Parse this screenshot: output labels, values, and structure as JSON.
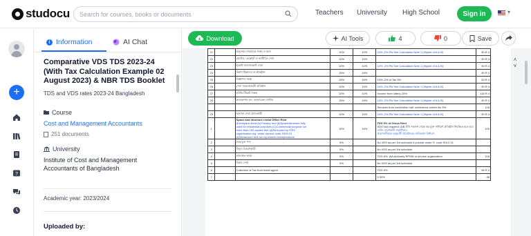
{
  "brand": {
    "name": "studocu"
  },
  "search": {
    "placeholder": "Search for courses, books or documents"
  },
  "nav": {
    "teachers": "Teachers",
    "university": "University",
    "high_school": "High School",
    "signin": "Sign in"
  },
  "sidebar_tabs": {
    "information": "Information",
    "ai_chat": "AI Chat"
  },
  "document": {
    "title": "Comparative VDS TDS 2023-24 (With Tax Calculation Example 02 August 2023) & NBR TDS Booklet",
    "subtitle": "TDS and VDS rates 2023-24 Bangladesh",
    "course_label": "Course",
    "course_name": "Cost and Management Accountants",
    "course_docs": "251 documents",
    "university_label": "University",
    "university_name": "Institute of Cost and Management Accountants of Bangladesh",
    "academic_year": "Academic year: 2023/2024",
    "uploaded_by": "Uploaded by:"
  },
  "toolbar": {
    "download": "Download",
    "ai_tools": "AI Tools",
    "likes": "4",
    "dislikes": "0",
    "save": "Save"
  },
  "colors": {
    "accent": "#1d6ff2",
    "green": "#1db954"
  },
  "icons": [
    "search-icon",
    "home-icon",
    "library-icon",
    "notes-icon",
    "quiz-icon",
    "chat-icon",
    "clock-icon",
    "cloud-download-icon",
    "sparkle-icon",
    "thumbs-up-icon",
    "thumbs-down-icon",
    "bookmark-icon",
    "share-icon"
  ],
  "table_rows": [
    {
      "n": "21",
      "d": "অনুচ্ছেদ-নামবাচক সংস্থা ও অন্য",
      "r": "10%",
      "r2": "10%",
      "x": "10%, 2% Pls See Calculation Note 1 (Higher of A & B)",
      "y": "90 R 4"
    },
    {
      "n": "22",
      "d": "হোটেল, রেস্তোরাঁ বা ক্যাটারিং সেবা",
      "r": "10%",
      "r2": "10%",
      "x": "",
      "y": "90 R 4"
    },
    {
      "n": "23",
      "d": "ইভেন্ট ম্যানেজমেন্ট সেবা",
      "r": "10%",
      "r2": "10%",
      "x": "10%, 2% Pls See Calculation Note 1 (Higher of A & B)",
      "y": "90 R 4"
    },
    {
      "n": "24",
      "d": "নির্মাণ ঠিকাদার বা প্রতিষ্ঠান",
      "r": "15%",
      "r2": "15%",
      "x": "",
      "y": "90 R 4"
    },
    {
      "n": "25",
      "d": "বিজ্ঞাপন সংস্থা",
      "r": "15%",
      "r2": "15%",
      "x": "10%, 2% of Tax 3%",
      "y": "53 R 4"
    },
    {
      "n": "26",
      "d": "সেবা সরবরাহকারী প্রতিষ্ঠান",
      "r": "10%",
      "r2": "10%",
      "x": "10%, 2% Pls See Calculation Note 1 (Higher of A & B)",
      "y": "90 R 4"
    },
    {
      "n": "27",
      "d": "লটারি টিকেট বিক্রয়",
      "r": "10%",
      "r2": "10%",
      "x": "Income from lottery 20%",
      "y": "118 R 4"
    },
    {
      "n": "28",
      "d": "কনভেনশন হল, কনফারেন্স সেন্টার",
      "r": "15%",
      "r2": "15%",
      "x": "10%, 2% Pls See Calculation Note 1 (Higher of A & B)",
      "y": "90 R 4"
    },
    {
      "n": "",
      "d": "",
      "r": "",
      "r2": "",
      "x": "Services from convention hall, conference centre etc 5%",
      "y": "118"
    },
    {
      "n": "29",
      "d": "অন্যান্য সেবা প্রদানকারী",
      "r": "10%",
      "r2": "10%",
      "x": "10%, 2% Pls See Calculation Note 1 (Higher of A & B)",
      "y": "90 R 4"
    }
  ],
  "tall_row": {
    "n": "1",
    "d_title": "Space and structure rental Office Rent",
    "d_lines": [
      "(Exemption Area (a) Factory rent (b)Space/structure fully",
      "used for residential purposes (C)Commercial purpose not",
      "more than 150 square feet (d)Rent paid by ITES",
      "organization reg. under service code S099.10",
      "(e)Showroom rent run by women entrepreneurs"
    ],
    "r": "15%",
    "r2": "15%",
    "x_title": "TDS 5% of Gross Rent",
    "x_lines": [
      "VDS Not required: A/B প্রতি শতাংশ থেকে কর মুক্ত সাধারণ প্রতিষ্ঠান নিবন্ধিত হতে হবে",
      "ব্যক্তি প্রেরণকারী স্বত্বাধিকার",
      "প্রয়োজনীয়তা অনুযায়ী প্রতিষ্ঠানের মালিকানা নির্ধারণ"
    ],
    "y": "109"
  },
  "lower_rows": [
    {
      "n": "2",
      "d": "শুল্ক মুক্ত পণ্য",
      "r": "5%",
      "r2": "",
      "x": "No VDS as per 3rd schedule if provide under S. code S012.14",
      "y": ""
    },
    {
      "n": "3",
      "d": "বিদ্যুৎ বিতরণকারী",
      "r": "5%",
      "r2": "",
      "x": "No VDS as per 3rd schedule",
      "y": ""
    },
    {
      "n": "4",
      "d": "যানবাহন ভাড়া",
      "r": "5%",
      "r2": "",
      "x": "TDS 6%, WA Authority RPOM or service organization",
      "y": "118"
    },
    {
      "n": "5",
      "d": "বিক্রয় সেবা",
      "r": "5%",
      "r2": "",
      "x": "No VDS as per 3rd schedule",
      "y": ""
    },
    {
      "n": "6",
      "d": "Collection of Tax from travel agent",
      "r": "",
      "r2": "",
      "x": "TDS 5%",
      "y": "98 R 4"
    },
    {
      "n": "7",
      "d": "",
      "r": "",
      "r2": "",
      "x": "0.30%",
      "y": "98"
    }
  ]
}
